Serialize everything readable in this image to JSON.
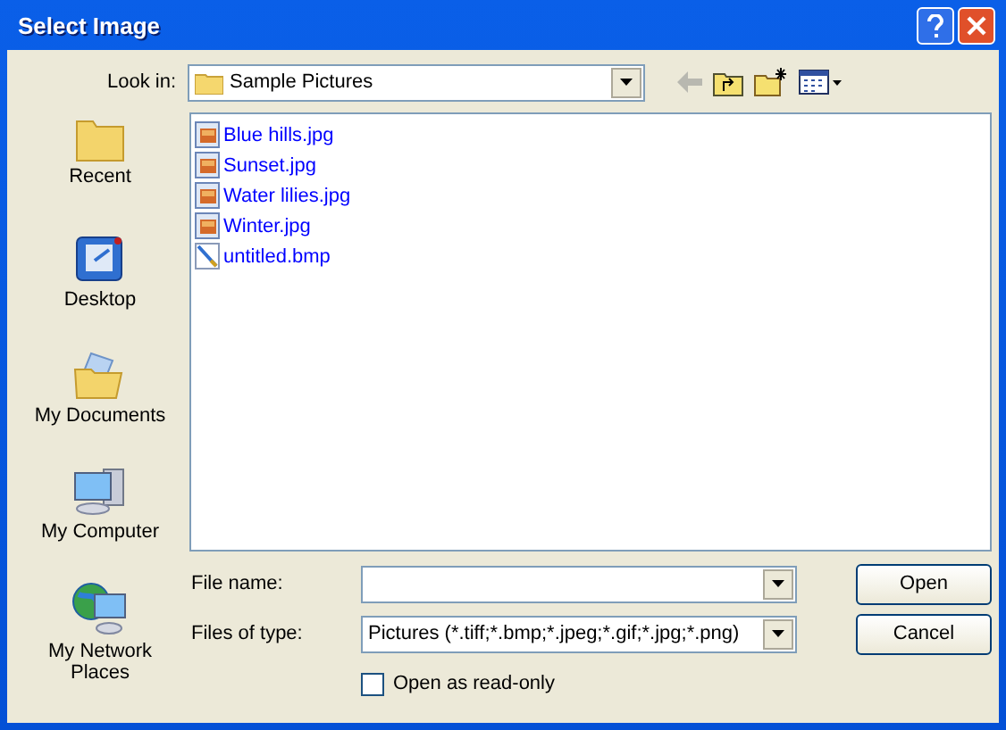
{
  "window": {
    "title": "Select Image"
  },
  "look_in": {
    "label": "Look in:",
    "value": "Sample Pictures"
  },
  "places": [
    {
      "label": "Recent",
      "kind": "recent"
    },
    {
      "label": "Desktop",
      "kind": "desktop"
    },
    {
      "label": "My Documents",
      "kind": "documents"
    },
    {
      "label": "My Computer",
      "kind": "computer"
    },
    {
      "label": "My Network Places",
      "kind": "network"
    }
  ],
  "files": [
    {
      "name": "Blue hills.jpg",
      "kind": "jpg"
    },
    {
      "name": "Sunset.jpg",
      "kind": "jpg"
    },
    {
      "name": "Water lilies.jpg",
      "kind": "jpg"
    },
    {
      "name": "Winter.jpg",
      "kind": "jpg"
    },
    {
      "name": "untitled.bmp",
      "kind": "bmp"
    }
  ],
  "file_name": {
    "label": "File name:"
  },
  "file_type": {
    "label": "Files of type:",
    "value": "Pictures (*.tiff;*.bmp;*.jpeg;*.gif;*.jpg;*.png)"
  },
  "read_only": {
    "label": "Open as read-only",
    "checked": false
  },
  "buttons": [
    "Open",
    "Cancel"
  ]
}
